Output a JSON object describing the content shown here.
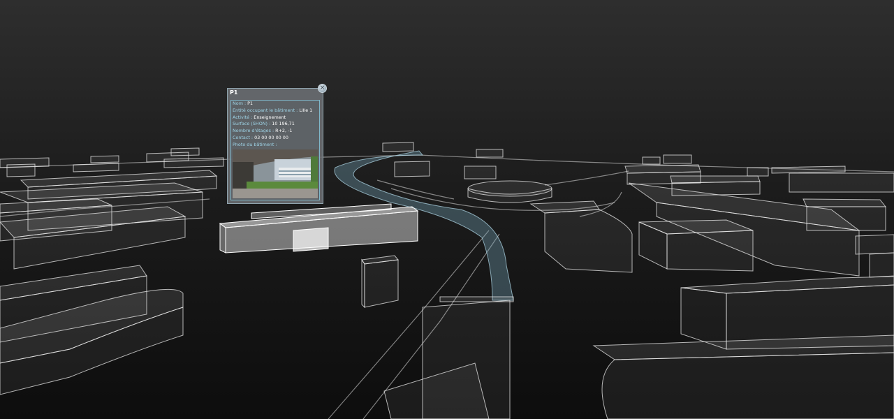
{
  "popup": {
    "title": "P1",
    "close_symbol": "×",
    "attributes": [
      {
        "label": "Nom :",
        "value": "P1"
      },
      {
        "label": "Entité occupant le bâtiment :",
        "value": "Lille 1"
      },
      {
        "label": "Activité :",
        "value": "Enseignement"
      },
      {
        "label": "Surface (SHON) :",
        "value": "10 196,71"
      },
      {
        "label": "Nombre d'étages :",
        "value": "R+2, -1"
      },
      {
        "label": "Contact :",
        "value": "03 00 00 00 00"
      },
      {
        "label": "Photo du bâtiment :",
        "value": ""
      }
    ]
  },
  "colors": {
    "label_accent": "#9ed3e6",
    "popup_border": "#7fb7c9",
    "selected_building": "#ffffff",
    "bridge": "#78aabe"
  },
  "icons": {
    "close": "close-icon"
  }
}
